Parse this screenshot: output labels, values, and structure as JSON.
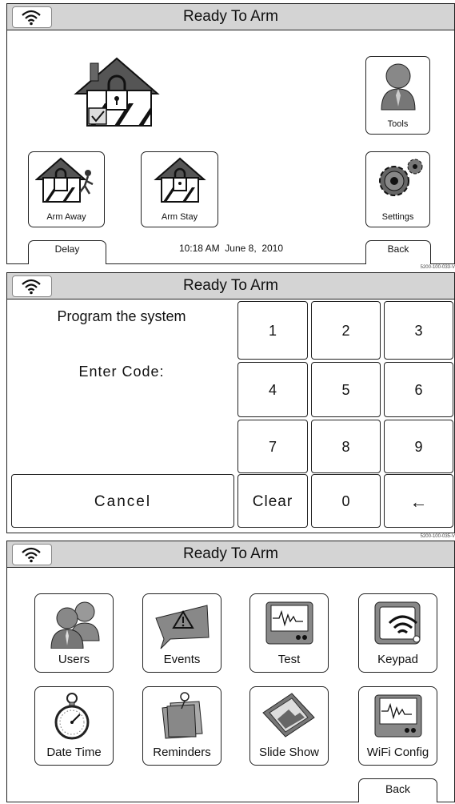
{
  "screens": [
    {
      "header": {
        "title": "Ready To Arm"
      },
      "tiles": {
        "tools": "Tools",
        "arm_away": "Arm Away",
        "arm_stay": "Arm Stay",
        "settings": "Settings"
      },
      "footer": {
        "delay": "Delay",
        "datetime": "10:18 AM  June 8,  2010",
        "back": "Back"
      },
      "ref": "5200-100-033-V"
    },
    {
      "header": {
        "title": "Ready To Arm"
      },
      "prompt": "Program the system",
      "code_label": "Enter Code:",
      "keys": [
        "1",
        "2",
        "3",
        "4",
        "5",
        "6",
        "7",
        "8",
        "9"
      ],
      "key_clear": "Clear",
      "key_zero": "0",
      "key_back": "←",
      "cancel": "Cancel",
      "ref": "5200-100-035-V"
    },
    {
      "header": {
        "title": "Ready To Arm"
      },
      "tiles": [
        "Users",
        "Events",
        "Test",
        "Keypad",
        "Date Time",
        "Reminders",
        "Slide Show",
        "WiFi Config"
      ],
      "back": "Back"
    }
  ]
}
